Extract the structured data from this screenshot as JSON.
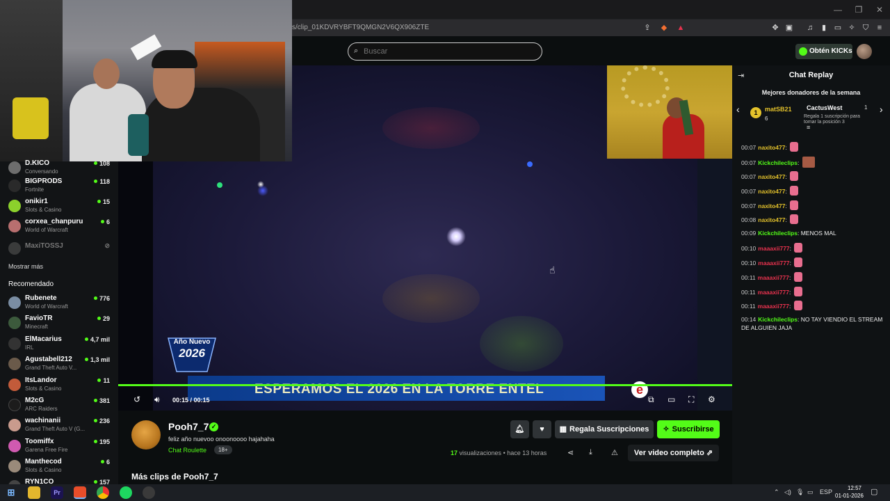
{
  "browser": {
    "url": "s/clip_01KDVRYBFT9QMGN2V6QX906ZTE",
    "window_min": "—",
    "window_max": "❐",
    "window_close": "✕"
  },
  "header": {
    "search_placeholder": "Buscar",
    "kicks_button": "Obtén KICKs"
  },
  "sidebar": {
    "following": [
      {
        "name": "D.KICO",
        "category": "Conversando",
        "count": "108",
        "avatar_color": "#6d6d6d"
      },
      {
        "name": "BIGPRODS",
        "category": "Fortnite",
        "count": "118",
        "avatar_color": "#2a2a2a"
      },
      {
        "name": "onikir1",
        "category": "Slots & Casino",
        "count": "15",
        "avatar_color": "#8cd12c"
      },
      {
        "name": "corxea_chanpuru",
        "category": "World of Warcraft",
        "count": "6",
        "avatar_color": "#b86f6f"
      },
      {
        "name": "MaxiTOSSJ",
        "category": "",
        "count": "",
        "avatar_color": "#555555"
      }
    ],
    "show_more": "Mostrar más",
    "recommended_heading": "Recomendado",
    "recommended": [
      {
        "name": "Rubenete",
        "category": "World of Warcraft",
        "count": "776",
        "avatar_color": "#7a8da3"
      },
      {
        "name": "FavioTR",
        "category": "Minecraft",
        "count": "29",
        "avatar_color": "#3c5a3c"
      },
      {
        "name": "ElMacarius",
        "category": "IRL",
        "count": "4,7 mil",
        "avatar_color": "#333333"
      },
      {
        "name": "Agustabell212",
        "category": "Grand Theft Auto V...",
        "count": "1,3 mil",
        "avatar_color": "#6a5a4a"
      },
      {
        "name": "ItsLandor",
        "category": "Slots & Casino",
        "count": "11",
        "avatar_color": "#c25b3a"
      },
      {
        "name": "M2cG",
        "category": "ARC Raiders",
        "count": "381",
        "avatar_color": "#1c1c1c"
      },
      {
        "name": "wachinanii",
        "category": "Grand Theft Auto V (G...",
        "count": "236",
        "avatar_color": "#c99b8d"
      },
      {
        "name": "Toomiffx",
        "category": "Garena Free Fire",
        "count": "195",
        "avatar_color": "#d05ab0"
      },
      {
        "name": "Manthecod",
        "category": "Slots & Casino",
        "count": "6",
        "avatar_color": "#9a8a7a"
      },
      {
        "name": "RYN1CO",
        "category": "",
        "count": "157",
        "avatar_color": "#444444"
      }
    ]
  },
  "video": {
    "badge_line1": "Año Nuevo",
    "badge_line2": "2026",
    "lower_third": "ESPERAMOS EL 2026 EN LA TORRE ENTEL",
    "time": "00:15 / 00:15",
    "progress_fraction": 1.0
  },
  "clip": {
    "channel_name": "Pooh7_7",
    "title": "feliz año nuevoo onoonoooo hajahaha",
    "category": "Chat Roulette",
    "age_badge": "18+",
    "gift_button": "Regala Suscripciones",
    "subscribe_button": "Suscribirse",
    "views_count": "17",
    "views_label": "visualizaciones",
    "time_ago": "hace 13 horas",
    "full_video_button": "Ver video completo",
    "more_clips": "Más clips de Pooh7_7"
  },
  "chat": {
    "title": "Chat Replay",
    "donors_title": "Mejores donadores de la semana",
    "donor1": {
      "rank": "1",
      "name": "matSB21",
      "count": "6"
    },
    "donor2": {
      "name": "CactusWest",
      "count": "1",
      "note": "Regala 1 suscripción para tomar la posición 3"
    },
    "messages": [
      {
        "ts": "00:07",
        "user": "naxito477",
        "color": "#e4c22b",
        "text": "",
        "emote": "pink"
      },
      {
        "ts": "00:07",
        "user": "Kickchileclips",
        "color": "#53fc18",
        "text": "",
        "emote": "square"
      },
      {
        "ts": "00:07",
        "user": "naxito477",
        "color": "#e4c22b",
        "text": "",
        "emote": "pink"
      },
      {
        "ts": "00:07",
        "user": "naxito477",
        "color": "#e4c22b",
        "text": "",
        "emote": "pink"
      },
      {
        "ts": "00:07",
        "user": "naxito477",
        "color": "#e4c22b",
        "text": "",
        "emote": "pink"
      },
      {
        "ts": "00:08",
        "user": "naxito477",
        "color": "#e4c22b",
        "text": "",
        "emote": "pink"
      },
      {
        "ts": "00:09",
        "user": "Kickchileclips",
        "color": "#53fc18",
        "text": "MENOS MAL",
        "emote": ""
      },
      {
        "ts": "00:10",
        "user": "maaaxii777",
        "color": "#e8324e",
        "text": "",
        "emote": "pink"
      },
      {
        "ts": "00:10",
        "user": "maaaxii777",
        "color": "#e8324e",
        "text": "",
        "emote": "pink"
      },
      {
        "ts": "00:11",
        "user": "maaaxii777",
        "color": "#e8324e",
        "text": "",
        "emote": "pink"
      },
      {
        "ts": "00:11",
        "user": "maaaxii777",
        "color": "#e8324e",
        "text": "",
        "emote": "pink"
      },
      {
        "ts": "00:11",
        "user": "maaaxii777",
        "color": "#e8324e",
        "text": "",
        "emote": "pink"
      },
      {
        "ts": "00:14",
        "user": "Kickchileclips",
        "color": "#53fc18",
        "text": "NO TAY VIENDIO EL STREAM DE ALGUIEN JAJA",
        "emote": ""
      }
    ]
  },
  "taskbar": {
    "lang": "ESP",
    "time": "12:57",
    "date": "01-01-2026"
  },
  "colors": {
    "accent": "#53fc18",
    "background": "#0b0e0f"
  }
}
